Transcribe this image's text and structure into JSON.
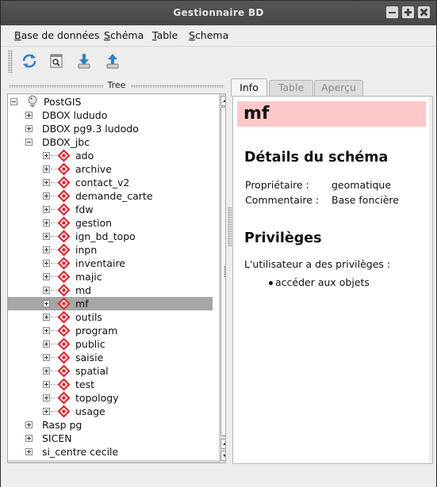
{
  "window": {
    "title": "Gestionnaire BD"
  },
  "menu": [
    {
      "pre": "",
      "u": "B",
      "post": "ase de données"
    },
    {
      "pre": "",
      "u": "S",
      "post": "chéma"
    },
    {
      "pre": "",
      "u": "T",
      "post": "able"
    },
    {
      "pre": "",
      "u": "S",
      "post": "chema"
    }
  ],
  "toolbar": {
    "buttons": [
      {
        "name": "refresh-icon"
      },
      {
        "name": "sql-window-icon"
      },
      {
        "name": "import-icon"
      },
      {
        "name": "export-icon"
      }
    ]
  },
  "tree": {
    "title": "Tree",
    "rows": [
      {
        "label": "PostGIS",
        "level": 0,
        "exp": "minus",
        "icon": "postgis"
      },
      {
        "label": "DBOX lududo",
        "level": 1,
        "exp": "plus",
        "icon": "none"
      },
      {
        "label": "DBOX pg9.3 ludodo",
        "level": 1,
        "exp": "plus",
        "icon": "none"
      },
      {
        "label": "DBOX_jbc",
        "level": 1,
        "exp": "minus",
        "icon": "none"
      },
      {
        "label": "ado",
        "level": 2,
        "exp": "plus",
        "icon": "schema"
      },
      {
        "label": "archive",
        "level": 2,
        "exp": "plus",
        "icon": "schema"
      },
      {
        "label": "contact_v2",
        "level": 2,
        "exp": "plus",
        "icon": "schema"
      },
      {
        "label": "demande_carte",
        "level": 2,
        "exp": "plus",
        "icon": "schema"
      },
      {
        "label": "fdw",
        "level": 2,
        "exp": "plus",
        "icon": "schema"
      },
      {
        "label": "gestion",
        "level": 2,
        "exp": "plus",
        "icon": "schema"
      },
      {
        "label": "ign_bd_topo",
        "level": 2,
        "exp": "plus",
        "icon": "schema"
      },
      {
        "label": "inpn",
        "level": 2,
        "exp": "plus",
        "icon": "schema"
      },
      {
        "label": "inventaire",
        "level": 2,
        "exp": "plus",
        "icon": "schema"
      },
      {
        "label": "majic",
        "level": 2,
        "exp": "plus",
        "icon": "schema"
      },
      {
        "label": "md",
        "level": 2,
        "exp": "plus",
        "icon": "schema"
      },
      {
        "label": "mf",
        "level": 2,
        "exp": "plus",
        "icon": "schema",
        "selected": true
      },
      {
        "label": "outils",
        "level": 2,
        "exp": "plus",
        "icon": "schema"
      },
      {
        "label": "program",
        "level": 2,
        "exp": "plus",
        "icon": "schema"
      },
      {
        "label": "public",
        "level": 2,
        "exp": "plus",
        "icon": "schema"
      },
      {
        "label": "saisie",
        "level": 2,
        "exp": "plus",
        "icon": "schema"
      },
      {
        "label": "spatial",
        "level": 2,
        "exp": "plus",
        "icon": "schema"
      },
      {
        "label": "test",
        "level": 2,
        "exp": "plus",
        "icon": "schema"
      },
      {
        "label": "topology",
        "level": 2,
        "exp": "plus",
        "icon": "schema"
      },
      {
        "label": "usage",
        "level": 2,
        "exp": "plus",
        "icon": "schema"
      },
      {
        "label": "Rasp pg",
        "level": 1,
        "exp": "plus",
        "icon": "none"
      },
      {
        "label": "SICEN",
        "level": 1,
        "exp": "plus",
        "icon": "none"
      },
      {
        "label": "si_centre cecile",
        "level": 1,
        "exp": "plus",
        "icon": "none"
      }
    ]
  },
  "tabs": [
    {
      "label": "Info",
      "active": true
    },
    {
      "label": "Table",
      "active": false
    },
    {
      "label": "Aperçu",
      "active": false
    }
  ],
  "info": {
    "header": "mf",
    "details_title": "Détails du schéma",
    "owner_label": "Propriétaire :",
    "owner_value": "geomatique",
    "comment_label": "Commentaire :",
    "comment_value": "Base foncière",
    "privileges_title": "Privilèges",
    "privileges_text": "L'utilisateur a des privilèges :",
    "privilege_item": "accéder aux objets"
  },
  "colors": {
    "header_bg": "#ffc8c8",
    "schema_icon": "#e0212e",
    "selection": "#a6a6a6"
  }
}
